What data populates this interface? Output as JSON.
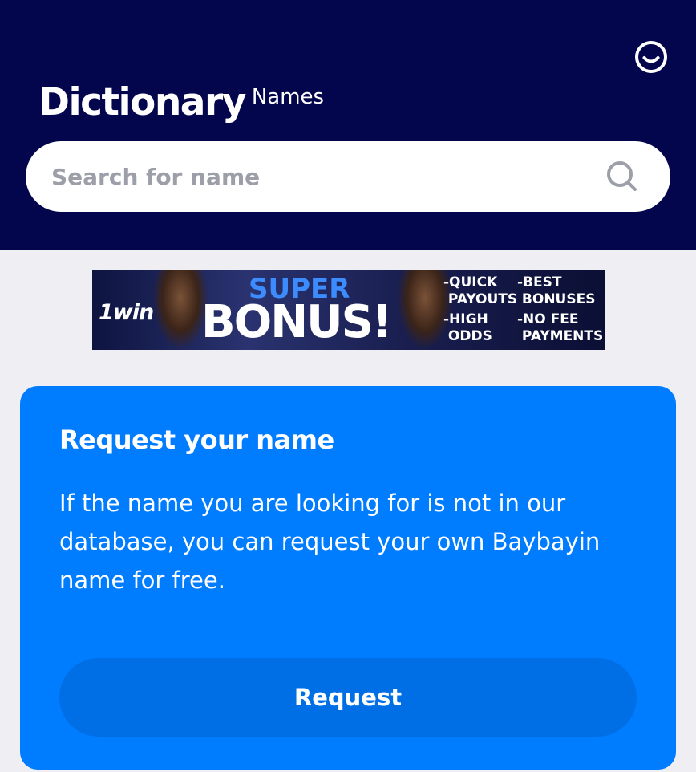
{
  "header": {
    "title": "Dictionary",
    "subtitle": "Names",
    "profile_icon": "smile-icon",
    "background": "#03064d"
  },
  "search": {
    "placeholder": "Search for name",
    "value": "",
    "icon": "search-icon"
  },
  "ad_banner": {
    "brand": "1win",
    "headline_top": "SUPER",
    "headline_main": "BONUS!",
    "features": [
      "-QUICK\n PAYOUTS",
      "-BEST\n BONUSES",
      "-HIGH\n ODDS",
      "-NO FEE\n PAYMENTS"
    ]
  },
  "request_card": {
    "title": "Request your name",
    "body": "If the name you are looking for is not in our database, you can request your own Baybayin name for free.",
    "button_label": "Request",
    "background": "#007cff",
    "button_color": "#006fe5"
  },
  "page_background": "#efeef3"
}
